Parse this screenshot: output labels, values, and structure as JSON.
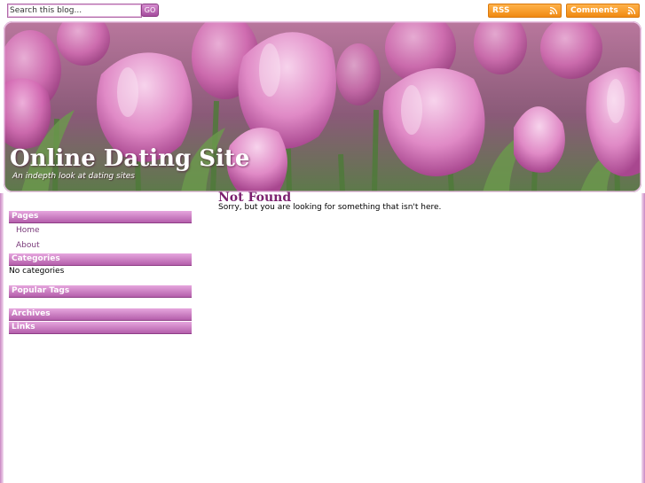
{
  "search": {
    "placeholder": "Search this blog...",
    "go_label": "GO"
  },
  "feeds": {
    "rss_label": "RSS",
    "comments_label": "Comments"
  },
  "header": {
    "title": "Online Dating Site",
    "tagline": "An indepth look at dating sites"
  },
  "sidebar": {
    "pages_heading": "Pages",
    "pages": [
      "Home",
      "About"
    ],
    "categories_heading": "Categories",
    "categories_text": "No categories",
    "tags_heading": "Popular Tags",
    "archives_heading": "Archives",
    "links_heading": "Links"
  },
  "main": {
    "heading": "Not Found",
    "message": "Sorry, but you are looking for something that isn't here."
  },
  "colors": {
    "accent": "#b45fab",
    "heading": "#7a1f6e",
    "feed_orange": "#f08a12"
  }
}
